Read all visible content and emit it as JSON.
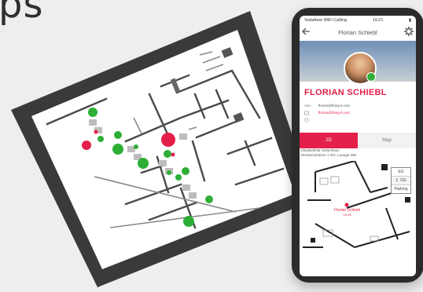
{
  "headline": {
    "fragment": "ps"
  },
  "tablet": {
    "description_icon": "floor-plan"
  },
  "phone": {
    "status": {
      "carrier": "Vodafone WiFi Calling",
      "time": "19:21"
    },
    "nav": {
      "title": "Florian Schiebl"
    },
    "profile": {
      "name": "FLORIAN SCHIEBL",
      "status_color": "#2eae37"
    },
    "contacts": [
      {
        "label": "Also",
        "value": "florian@thing-it.com"
      },
      {
        "label": "",
        "value": "florian@thing-it.com"
      }
    ],
    "tabs": [
      {
        "label": "2D"
      },
      {
        "label": "Map"
      }
    ],
    "location": {
      "line1": "Elisabeth/str Seitenhaus",
      "line2": "Rechenzentrum 1 OG, Lounge 268"
    },
    "map": {
      "user_label": "Florian Schiebl",
      "user_time": "19:45",
      "floors": [
        {
          "label": "EG"
        },
        {
          "label": "1. OG"
        },
        {
          "label": "Parking"
        }
      ]
    }
  },
  "colors": {
    "accent": "#e31f4a",
    "available": "#2eae37",
    "occupied": "#e31f4a"
  }
}
